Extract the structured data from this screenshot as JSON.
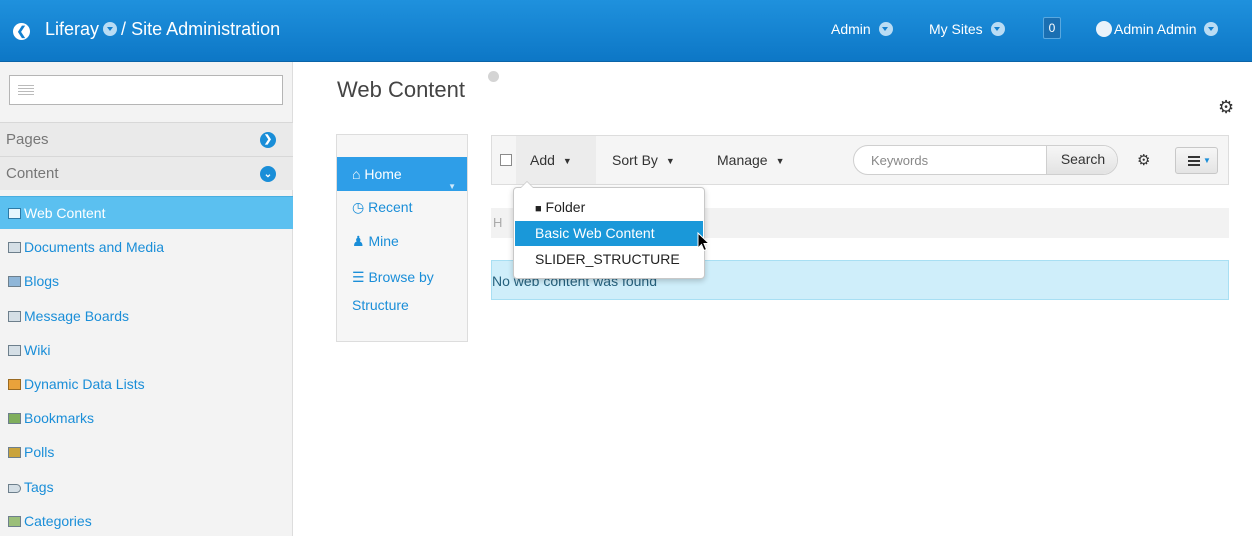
{
  "header": {
    "brand": "Liferay",
    "separator": "/",
    "title": "Site Administration",
    "menu_admin": "Admin",
    "menu_mysites": "My Sites",
    "notifications_count": "0",
    "user_name": "Admin Admin"
  },
  "sidebar": {
    "sections": [
      {
        "label": "Pages",
        "state": "collapsed"
      },
      {
        "label": "Content",
        "state": "expanded"
      }
    ],
    "items": [
      {
        "label": "Web Content",
        "active": true
      },
      {
        "label": "Documents and Media"
      },
      {
        "label": "Blogs"
      },
      {
        "label": "Message Boards"
      },
      {
        "label": "Wiki"
      },
      {
        "label": "Dynamic Data Lists"
      },
      {
        "label": "Bookmarks"
      },
      {
        "label": "Polls"
      },
      {
        "label": "Tags"
      },
      {
        "label": "Categories"
      }
    ]
  },
  "main": {
    "title": "Web Content",
    "folder_nav": {
      "items": [
        "Home",
        "Recent",
        "Mine"
      ],
      "browse_line1": "Browse by",
      "browse_line2": "Structure"
    },
    "toolbar": {
      "add_label": "Add",
      "sortby_label": "Sort By",
      "manage_label": "Manage",
      "search_placeholder": "Keywords",
      "search_button": "Search"
    },
    "breadcrumb_initial": "H",
    "empty_message": "No web content was found"
  },
  "add_menu": {
    "items": [
      "Folder",
      "Basic Web Content",
      "SLIDER_STRUCTURE"
    ],
    "highlighted": "Basic Web Content"
  },
  "colors": {
    "topbar": "#1488d8",
    "accent": "#1a8ed8",
    "sidebar_active": "#5bc0f0",
    "alert_bg": "#cfeefa"
  }
}
